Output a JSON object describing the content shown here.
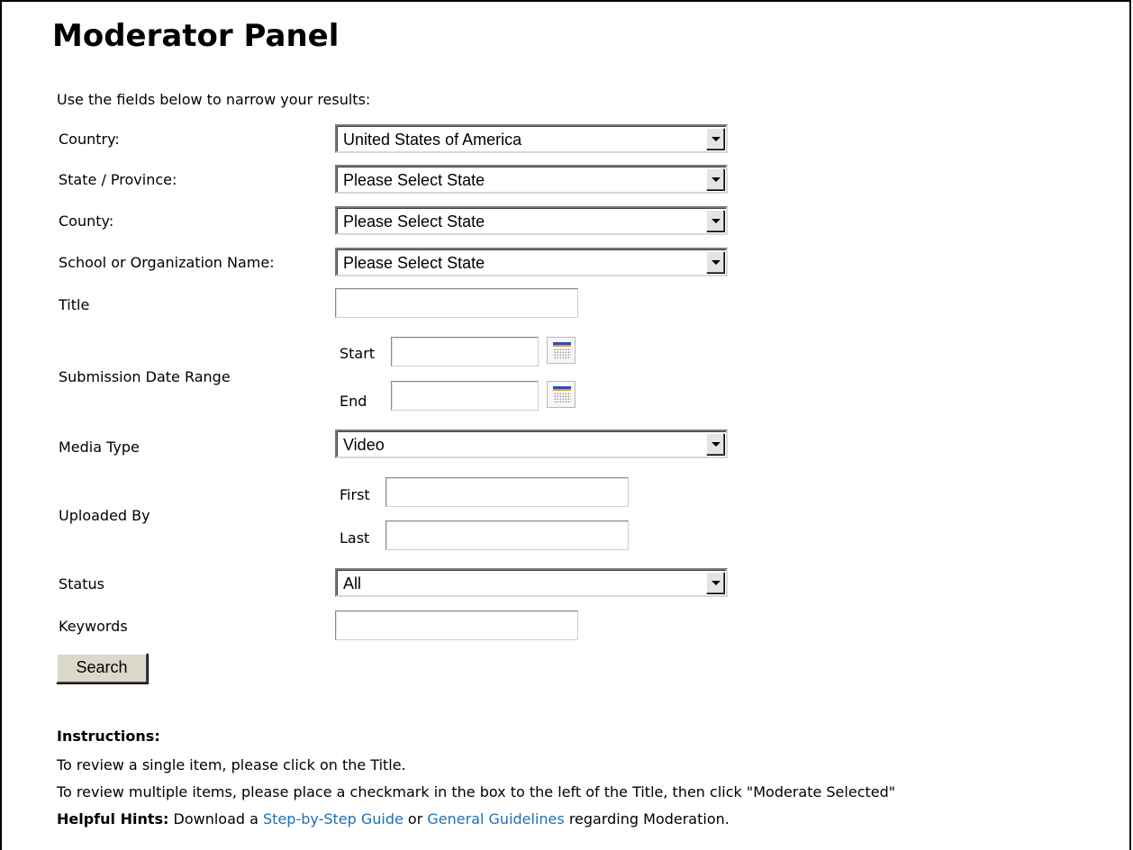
{
  "page": {
    "title": "Moderator Panel",
    "intro": "Use the fields below to narrow your results:"
  },
  "filters": {
    "country_label": "Country:",
    "country_value": "United States of America",
    "state_label": "State / Province:",
    "state_value": "Please Select State",
    "county_label": "County:",
    "county_value": "Please Select State",
    "school_label": "School or Organization Name:",
    "school_value": "Please Select State",
    "title_label": "Title",
    "title_value": "",
    "date_label": "Submission Date Range",
    "start_label": "Start",
    "start_value": "",
    "end_label": "End",
    "end_value": "",
    "media_label": "Media Type",
    "media_value": "Video",
    "uploaded_label": "Uploaded By",
    "first_label": "First",
    "first_value": "",
    "last_label": "Last",
    "last_value": "",
    "status_label": "Status",
    "status_value": "All",
    "keywords_label": "Keywords",
    "keywords_value": "",
    "search_button": "Search"
  },
  "instructions": {
    "heading": "Instructions:",
    "line1": "To review a single item, please click on the Title.",
    "line2": "To review multiple items, please place a checkmark in the box to the left of the Title, then click \"Moderate Selected\"",
    "hints_label": "Helpful Hints:",
    "hints_pre": " Download a ",
    "guide_link": "Step-by-Step Guide",
    "hints_mid": " or ",
    "guidelines_link": "General Guidelines",
    "hints_post": " regarding Moderation."
  },
  "icons": {
    "calendar": "calendar-icon",
    "dropdown": "chevron-down-icon"
  },
  "colors": {
    "link": "#1f6fb5",
    "button_face": "#ddd8cc"
  }
}
